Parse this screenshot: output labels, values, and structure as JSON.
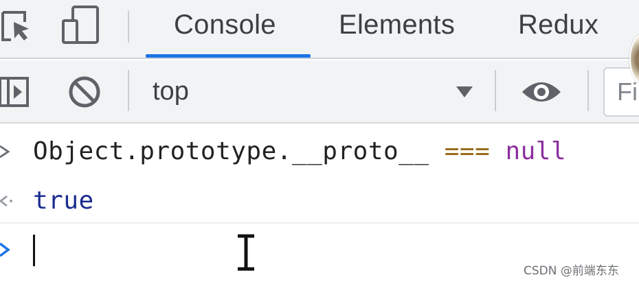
{
  "tabs": {
    "items": [
      {
        "label": "Console",
        "active": true
      },
      {
        "label": "Elements",
        "active": false
      },
      {
        "label": "Redux",
        "active": false
      }
    ],
    "accent_color": "#1a73e8",
    "left_icons": [
      "inspect-element-icon",
      "device-toolbar-icon"
    ]
  },
  "toolbar": {
    "left_icons": [
      "sidebar-toggle-icon",
      "clear-console-icon"
    ],
    "context": "top",
    "right_icons": [
      "live-expression-eye-icon"
    ],
    "filter_placeholder": "Fi"
  },
  "console": {
    "input": {
      "object": "Object.prototype.__proto__",
      "operator": "===",
      "literal": "null"
    },
    "result": "true",
    "prompt_value": "",
    "colors": {
      "identifier": "#222222",
      "operator": "#9a6b1b",
      "null": "#8b2f9e",
      "true": "#1b2c8f"
    }
  },
  "watermark": "CSDN @前端东东"
}
